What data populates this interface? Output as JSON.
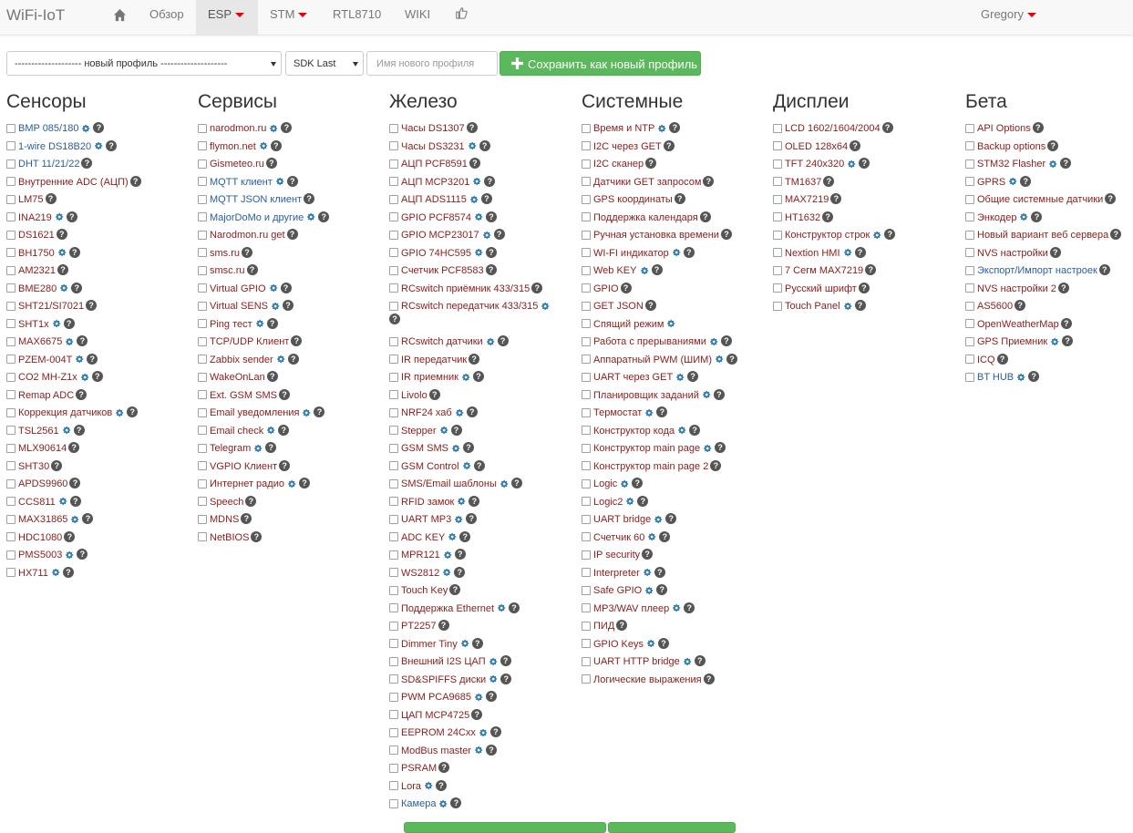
{
  "navbar": {
    "brand": "WiFi-IoT",
    "items": [
      {
        "label": "Обзор"
      },
      {
        "label": "ESP"
      },
      {
        "label": "STM"
      },
      {
        "label": "RTL8710"
      },
      {
        "label": "WIKI"
      }
    ],
    "user": "Gregory"
  },
  "toolbar": {
    "profile_select": "-------------------- новый профиль --------------------",
    "sdk_select": "SDK Last",
    "profile_name_placeholder": "Имя нового профиля",
    "save_button": "Сохранить как новый профиль"
  },
  "colors": {
    "red_link": "#8b1c1c",
    "blue_link": "#2a5d9f",
    "accent": "#2a7ab0",
    "save": "#5cb85c"
  },
  "columns": [
    {
      "title": "Сенсоры",
      "items": [
        {
          "label": "BMP 085/180",
          "color": "blue",
          "gear": true,
          "help": true
        },
        {
          "label": "1-wire DS18B20",
          "color": "blue",
          "gear": true,
          "help": true
        },
        {
          "label": "DHT 11/21/22",
          "color": "blue",
          "gear": false,
          "help": true
        },
        {
          "label": "Внутренние ADC (АЦП)",
          "color": "red",
          "gear": false,
          "help": true
        },
        {
          "label": "LM75",
          "color": "red",
          "gear": false,
          "help": true
        },
        {
          "label": "INA219",
          "color": "red",
          "gear": true,
          "help": true
        },
        {
          "label": "DS1621",
          "color": "red",
          "gear": false,
          "help": true
        },
        {
          "label": "BH1750",
          "color": "red",
          "gear": true,
          "help": true
        },
        {
          "label": "AM2321",
          "color": "red",
          "gear": false,
          "help": true
        },
        {
          "label": "BME280",
          "color": "red",
          "gear": true,
          "help": true
        },
        {
          "label": "SHT21/SI7021",
          "color": "red",
          "gear": false,
          "help": true
        },
        {
          "label": "SHT1x",
          "color": "red",
          "gear": true,
          "help": true
        },
        {
          "label": "MAX6675",
          "color": "red",
          "gear": true,
          "help": true
        },
        {
          "label": "PZEM-004T",
          "color": "red",
          "gear": true,
          "help": true
        },
        {
          "label": "CO2 MH-Z1x",
          "color": "red",
          "gear": true,
          "help": true
        },
        {
          "label": "Remap ADC",
          "color": "red",
          "gear": false,
          "help": true
        },
        {
          "label": "Коррекция датчиков",
          "color": "red",
          "gear": true,
          "help": true
        },
        {
          "label": "TSL2561",
          "color": "red",
          "gear": true,
          "help": true
        },
        {
          "label": "MLX90614",
          "color": "red",
          "gear": false,
          "help": true
        },
        {
          "label": "SHT30",
          "color": "red",
          "gear": false,
          "help": true
        },
        {
          "label": "APDS9960",
          "color": "red",
          "gear": false,
          "help": true
        },
        {
          "label": "CCS811",
          "color": "red",
          "gear": true,
          "help": true
        },
        {
          "label": "MAX31865",
          "color": "red",
          "gear": true,
          "help": true
        },
        {
          "label": "HDC1080",
          "color": "red",
          "gear": false,
          "help": true
        },
        {
          "label": "PMS5003",
          "color": "red",
          "gear": true,
          "help": true
        },
        {
          "label": "HX711",
          "color": "red",
          "gear": true,
          "help": true
        }
      ]
    },
    {
      "title": "Сервисы",
      "items": [
        {
          "label": "narodmon.ru",
          "color": "red",
          "gear": true,
          "help": true
        },
        {
          "label": "flymon.net",
          "color": "red",
          "gear": true,
          "help": true
        },
        {
          "label": "Gismeteo.ru",
          "color": "red",
          "gear": false,
          "help": true
        },
        {
          "label": "MQTT клиент",
          "color": "blue",
          "gear": true,
          "help": true
        },
        {
          "label": "MQTT JSON клиент",
          "color": "blue",
          "gear": false,
          "help": true
        },
        {
          "label": "MajorDoMo и другие",
          "color": "blue",
          "gear": true,
          "help": true
        },
        {
          "label": "Narodmon.ru get",
          "color": "red",
          "gear": false,
          "help": true
        },
        {
          "label": "sms.ru",
          "color": "red",
          "gear": false,
          "help": true
        },
        {
          "label": "smsc.ru",
          "color": "red",
          "gear": false,
          "help": true
        },
        {
          "label": "Virtual GPIO",
          "color": "red",
          "gear": true,
          "help": true
        },
        {
          "label": "Virtual SENS",
          "color": "red",
          "gear": true,
          "help": true
        },
        {
          "label": "Ping тест",
          "color": "red",
          "gear": true,
          "help": true
        },
        {
          "label": "TCP/UDP Клиент",
          "color": "red",
          "gear": false,
          "help": true
        },
        {
          "label": "Zabbix sender",
          "color": "red",
          "gear": true,
          "help": true
        },
        {
          "label": "WakeOnLan",
          "color": "red",
          "gear": false,
          "help": true
        },
        {
          "label": "Ext. GSM SMS",
          "color": "red",
          "gear": false,
          "help": true
        },
        {
          "label": "Email уведомления",
          "color": "red",
          "gear": true,
          "help": true
        },
        {
          "label": "Email check",
          "color": "red",
          "gear": true,
          "help": true
        },
        {
          "label": "Telegram",
          "color": "red",
          "gear": true,
          "help": true
        },
        {
          "label": "VGPIO Клиент",
          "color": "red",
          "gear": false,
          "help": true
        },
        {
          "label": "Интернет радио",
          "color": "red",
          "gear": true,
          "help": true
        },
        {
          "label": "Speech",
          "color": "red",
          "gear": false,
          "help": true
        },
        {
          "label": "MDNS",
          "color": "red",
          "gear": false,
          "help": true
        },
        {
          "label": "NetBIOS",
          "color": "red",
          "gear": false,
          "help": true
        }
      ]
    },
    {
      "title": "Железо",
      "items": [
        {
          "label": "Часы DS1307",
          "color": "red",
          "gear": false,
          "help": true
        },
        {
          "label": "Часы DS3231",
          "color": "red",
          "gear": true,
          "help": true
        },
        {
          "label": "АЦП PCF8591",
          "color": "red",
          "gear": false,
          "help": true
        },
        {
          "label": "АЦП MCP3201",
          "color": "red",
          "gear": true,
          "help": true
        },
        {
          "label": "АЦП ADS1115",
          "color": "red",
          "gear": true,
          "help": true
        },
        {
          "label": "GPIO PCF8574",
          "color": "red",
          "gear": true,
          "help": true
        },
        {
          "label": "GPIO MCP23017",
          "color": "red",
          "gear": true,
          "help": true
        },
        {
          "label": "GPIO 74HC595",
          "color": "red",
          "gear": true,
          "help": true
        },
        {
          "label": "Счетчик PCF8583",
          "color": "red",
          "gear": false,
          "help": true
        },
        {
          "label": "RCswitch приёмник 433/315",
          "color": "red",
          "gear": false,
          "help": true
        },
        {
          "label": "RCswitch передатчик 433/315",
          "color": "red",
          "gear": true,
          "help": true,
          "wrap": true
        },
        {
          "label": "RCswitch датчики",
          "color": "red",
          "gear": true,
          "help": true
        },
        {
          "label": "IR передатчик",
          "color": "red",
          "gear": false,
          "help": true
        },
        {
          "label": "IR приемник",
          "color": "red",
          "gear": true,
          "help": true
        },
        {
          "label": "Livolo",
          "color": "red",
          "gear": false,
          "help": true
        },
        {
          "label": "NRF24 хаб",
          "color": "red",
          "gear": true,
          "help": true
        },
        {
          "label": "Stepper",
          "color": "red",
          "gear": true,
          "help": true
        },
        {
          "label": "GSM SMS",
          "color": "red",
          "gear": true,
          "help": true
        },
        {
          "label": "GSM Control",
          "color": "red",
          "gear": true,
          "help": true
        },
        {
          "label": "SMS/Email шаблоны",
          "color": "red",
          "gear": true,
          "help": true
        },
        {
          "label": "RFID замок",
          "color": "red",
          "gear": true,
          "help": true
        },
        {
          "label": "UART MP3",
          "color": "red",
          "gear": true,
          "help": true
        },
        {
          "label": "ADC KEY",
          "color": "red",
          "gear": true,
          "help": true
        },
        {
          "label": "MPR121",
          "color": "red",
          "gear": true,
          "help": true
        },
        {
          "label": "WS2812",
          "color": "red",
          "gear": true,
          "help": true
        },
        {
          "label": "Touch Key",
          "color": "red",
          "gear": false,
          "help": true
        },
        {
          "label": "Поддержка Ethernet",
          "color": "red",
          "gear": true,
          "help": true
        },
        {
          "label": "PT2257",
          "color": "red",
          "gear": false,
          "help": true
        },
        {
          "label": "Dimmer Tiny",
          "color": "red",
          "gear": true,
          "help": true
        },
        {
          "label": "Внешний I2S ЦАП",
          "color": "red",
          "gear": true,
          "help": true
        },
        {
          "label": "SD&SPIFFS диски",
          "color": "red",
          "gear": true,
          "help": true
        },
        {
          "label": "PWM PCA9685",
          "color": "red",
          "gear": true,
          "help": true
        },
        {
          "label": "ЦАП MCP4725",
          "color": "red",
          "gear": false,
          "help": true
        },
        {
          "label": "EEPROM 24Cxx",
          "color": "red",
          "gear": true,
          "help": true
        },
        {
          "label": "ModBus master",
          "color": "red",
          "gear": true,
          "help": true
        },
        {
          "label": "PSRAM",
          "color": "red",
          "gear": false,
          "help": true
        },
        {
          "label": "Lora",
          "color": "red",
          "gear": true,
          "help": true
        },
        {
          "label": "Камера",
          "color": "blue",
          "gear": true,
          "help": true
        }
      ]
    },
    {
      "title": "Системные",
      "items": [
        {
          "label": "Время и NTP",
          "color": "red",
          "gear": true,
          "help": true
        },
        {
          "label": "I2C через GET",
          "color": "red",
          "gear": false,
          "help": true
        },
        {
          "label": "I2C сканер",
          "color": "red",
          "gear": false,
          "help": true
        },
        {
          "label": "Датчики GET запросом",
          "color": "red",
          "gear": false,
          "help": true
        },
        {
          "label": "GPS координаты",
          "color": "red",
          "gear": false,
          "help": true
        },
        {
          "label": "Поддержка календаря",
          "color": "red",
          "gear": false,
          "help": true
        },
        {
          "label": "Ручная установка времени",
          "color": "red",
          "gear": false,
          "help": true
        },
        {
          "label": "WI-FI индикатор",
          "color": "red",
          "gear": true,
          "help": true
        },
        {
          "label": "Web KEY",
          "color": "red",
          "gear": true,
          "help": true
        },
        {
          "label": "GPIO",
          "color": "red",
          "gear": false,
          "help": true
        },
        {
          "label": "GET JSON",
          "color": "red",
          "gear": false,
          "help": true
        },
        {
          "label": "Спящий режим",
          "color": "red",
          "gear": true,
          "help": false
        },
        {
          "label": "Работа с прерываниями",
          "color": "red",
          "gear": true,
          "help": true
        },
        {
          "label": "Аппаратный PWM (ШИМ)",
          "color": "red",
          "gear": true,
          "help": true
        },
        {
          "label": "UART через GET",
          "color": "red",
          "gear": true,
          "help": true
        },
        {
          "label": "Планировщик заданий",
          "color": "red",
          "gear": true,
          "help": true
        },
        {
          "label": "Термостат",
          "color": "red",
          "gear": true,
          "help": true
        },
        {
          "label": "Конструктор кода",
          "color": "red",
          "gear": true,
          "help": true
        },
        {
          "label": "Конструктор main page",
          "color": "red",
          "gear": true,
          "help": true
        },
        {
          "label": "Конструктор main page 2",
          "color": "red",
          "gear": false,
          "help": true
        },
        {
          "label": "Logic",
          "color": "red",
          "gear": true,
          "help": true
        },
        {
          "label": "Logic2",
          "color": "red",
          "gear": true,
          "help": true
        },
        {
          "label": "UART bridge",
          "color": "red",
          "gear": true,
          "help": true
        },
        {
          "label": "Счетчик 60",
          "color": "red",
          "gear": true,
          "help": true
        },
        {
          "label": "IP security",
          "color": "red",
          "gear": false,
          "help": true
        },
        {
          "label": "Interpreter",
          "color": "red",
          "gear": true,
          "help": true
        },
        {
          "label": "Safe GPIO",
          "color": "red",
          "gear": true,
          "help": true
        },
        {
          "label": "MP3/WAV плеер",
          "color": "red",
          "gear": true,
          "help": true
        },
        {
          "label": "ПИД",
          "color": "red",
          "gear": false,
          "help": true
        },
        {
          "label": "GPIO Keys",
          "color": "red",
          "gear": true,
          "help": true
        },
        {
          "label": "UART HTTP bridge",
          "color": "red",
          "gear": true,
          "help": true
        },
        {
          "label": "Логические выражения",
          "color": "red",
          "gear": false,
          "help": true
        }
      ]
    },
    {
      "title": "Дисплеи",
      "items": [
        {
          "label": "LCD 1602/1604/2004",
          "color": "red",
          "gear": false,
          "help": true
        },
        {
          "label": "OLED 128x64",
          "color": "red",
          "gear": false,
          "help": true
        },
        {
          "label": "TFT 240x320",
          "color": "red",
          "gear": true,
          "help": true
        },
        {
          "label": "TM1637",
          "color": "red",
          "gear": false,
          "help": true
        },
        {
          "label": "MAX7219",
          "color": "red",
          "gear": false,
          "help": true
        },
        {
          "label": "HT1632",
          "color": "red",
          "gear": false,
          "help": true
        },
        {
          "label": "Конструктор строк",
          "color": "red",
          "gear": true,
          "help": true
        },
        {
          "label": "Nextion HMI",
          "color": "red",
          "gear": true,
          "help": true
        },
        {
          "label": "7 Сегм MAX7219",
          "color": "red",
          "gear": false,
          "help": true
        },
        {
          "label": "Русский шрифт",
          "color": "red",
          "gear": false,
          "help": true
        },
        {
          "label": "Touch Panel",
          "color": "red",
          "gear": true,
          "help": true
        }
      ]
    },
    {
      "title": "Бета",
      "items": [
        {
          "label": "API Options",
          "color": "red",
          "gear": false,
          "help": true
        },
        {
          "label": "Backup options",
          "color": "red",
          "gear": false,
          "help": true
        },
        {
          "label": "STM32 Flasher",
          "color": "red",
          "gear": true,
          "help": true
        },
        {
          "label": "GPRS",
          "color": "red",
          "gear": true,
          "help": true
        },
        {
          "label": "Общие системные датчики",
          "color": "red",
          "gear": false,
          "help": true
        },
        {
          "label": "Энкодер",
          "color": "red",
          "gear": true,
          "help": true
        },
        {
          "label": "Новый вариант веб сервера",
          "color": "red",
          "gear": false,
          "help": true
        },
        {
          "label": "NVS настройки",
          "color": "red",
          "gear": false,
          "help": true
        },
        {
          "label": "Экспорт/Импорт настроек",
          "color": "blue",
          "gear": false,
          "help": true
        },
        {
          "label": "NVS настройки 2",
          "color": "red",
          "gear": false,
          "help": true
        },
        {
          "label": "AS5600",
          "color": "red",
          "gear": false,
          "help": true
        },
        {
          "label": "OpenWeatherMap",
          "color": "red",
          "gear": false,
          "help": true
        },
        {
          "label": "GPS Приемник",
          "color": "red",
          "gear": true,
          "help": true
        },
        {
          "label": "ICQ",
          "color": "red",
          "gear": false,
          "help": true
        },
        {
          "label": "BT HUB",
          "color": "blue",
          "gear": true,
          "help": true
        }
      ]
    }
  ]
}
